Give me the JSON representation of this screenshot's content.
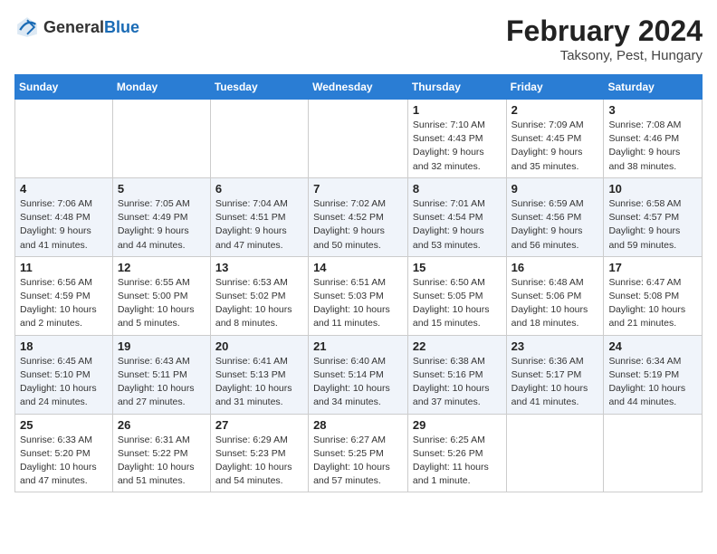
{
  "header": {
    "logo_general": "General",
    "logo_blue": "Blue",
    "month_title": "February 2024",
    "location": "Taksony, Pest, Hungary"
  },
  "days_of_week": [
    "Sunday",
    "Monday",
    "Tuesday",
    "Wednesday",
    "Thursday",
    "Friday",
    "Saturday"
  ],
  "weeks": [
    [
      {
        "day": "",
        "info": ""
      },
      {
        "day": "",
        "info": ""
      },
      {
        "day": "",
        "info": ""
      },
      {
        "day": "",
        "info": ""
      },
      {
        "day": "1",
        "info": "Sunrise: 7:10 AM\nSunset: 4:43 PM\nDaylight: 9 hours\nand 32 minutes."
      },
      {
        "day": "2",
        "info": "Sunrise: 7:09 AM\nSunset: 4:45 PM\nDaylight: 9 hours\nand 35 minutes."
      },
      {
        "day": "3",
        "info": "Sunrise: 7:08 AM\nSunset: 4:46 PM\nDaylight: 9 hours\nand 38 minutes."
      }
    ],
    [
      {
        "day": "4",
        "info": "Sunrise: 7:06 AM\nSunset: 4:48 PM\nDaylight: 9 hours\nand 41 minutes."
      },
      {
        "day": "5",
        "info": "Sunrise: 7:05 AM\nSunset: 4:49 PM\nDaylight: 9 hours\nand 44 minutes."
      },
      {
        "day": "6",
        "info": "Sunrise: 7:04 AM\nSunset: 4:51 PM\nDaylight: 9 hours\nand 47 minutes."
      },
      {
        "day": "7",
        "info": "Sunrise: 7:02 AM\nSunset: 4:52 PM\nDaylight: 9 hours\nand 50 minutes."
      },
      {
        "day": "8",
        "info": "Sunrise: 7:01 AM\nSunset: 4:54 PM\nDaylight: 9 hours\nand 53 minutes."
      },
      {
        "day": "9",
        "info": "Sunrise: 6:59 AM\nSunset: 4:56 PM\nDaylight: 9 hours\nand 56 minutes."
      },
      {
        "day": "10",
        "info": "Sunrise: 6:58 AM\nSunset: 4:57 PM\nDaylight: 9 hours\nand 59 minutes."
      }
    ],
    [
      {
        "day": "11",
        "info": "Sunrise: 6:56 AM\nSunset: 4:59 PM\nDaylight: 10 hours\nand 2 minutes."
      },
      {
        "day": "12",
        "info": "Sunrise: 6:55 AM\nSunset: 5:00 PM\nDaylight: 10 hours\nand 5 minutes."
      },
      {
        "day": "13",
        "info": "Sunrise: 6:53 AM\nSunset: 5:02 PM\nDaylight: 10 hours\nand 8 minutes."
      },
      {
        "day": "14",
        "info": "Sunrise: 6:51 AM\nSunset: 5:03 PM\nDaylight: 10 hours\nand 11 minutes."
      },
      {
        "day": "15",
        "info": "Sunrise: 6:50 AM\nSunset: 5:05 PM\nDaylight: 10 hours\nand 15 minutes."
      },
      {
        "day": "16",
        "info": "Sunrise: 6:48 AM\nSunset: 5:06 PM\nDaylight: 10 hours\nand 18 minutes."
      },
      {
        "day": "17",
        "info": "Sunrise: 6:47 AM\nSunset: 5:08 PM\nDaylight: 10 hours\nand 21 minutes."
      }
    ],
    [
      {
        "day": "18",
        "info": "Sunrise: 6:45 AM\nSunset: 5:10 PM\nDaylight: 10 hours\nand 24 minutes."
      },
      {
        "day": "19",
        "info": "Sunrise: 6:43 AM\nSunset: 5:11 PM\nDaylight: 10 hours\nand 27 minutes."
      },
      {
        "day": "20",
        "info": "Sunrise: 6:41 AM\nSunset: 5:13 PM\nDaylight: 10 hours\nand 31 minutes."
      },
      {
        "day": "21",
        "info": "Sunrise: 6:40 AM\nSunset: 5:14 PM\nDaylight: 10 hours\nand 34 minutes."
      },
      {
        "day": "22",
        "info": "Sunrise: 6:38 AM\nSunset: 5:16 PM\nDaylight: 10 hours\nand 37 minutes."
      },
      {
        "day": "23",
        "info": "Sunrise: 6:36 AM\nSunset: 5:17 PM\nDaylight: 10 hours\nand 41 minutes."
      },
      {
        "day": "24",
        "info": "Sunrise: 6:34 AM\nSunset: 5:19 PM\nDaylight: 10 hours\nand 44 minutes."
      }
    ],
    [
      {
        "day": "25",
        "info": "Sunrise: 6:33 AM\nSunset: 5:20 PM\nDaylight: 10 hours\nand 47 minutes."
      },
      {
        "day": "26",
        "info": "Sunrise: 6:31 AM\nSunset: 5:22 PM\nDaylight: 10 hours\nand 51 minutes."
      },
      {
        "day": "27",
        "info": "Sunrise: 6:29 AM\nSunset: 5:23 PM\nDaylight: 10 hours\nand 54 minutes."
      },
      {
        "day": "28",
        "info": "Sunrise: 6:27 AM\nSunset: 5:25 PM\nDaylight: 10 hours\nand 57 minutes."
      },
      {
        "day": "29",
        "info": "Sunrise: 6:25 AM\nSunset: 5:26 PM\nDaylight: 11 hours\nand 1 minute."
      },
      {
        "day": "",
        "info": ""
      },
      {
        "day": "",
        "info": ""
      }
    ]
  ]
}
